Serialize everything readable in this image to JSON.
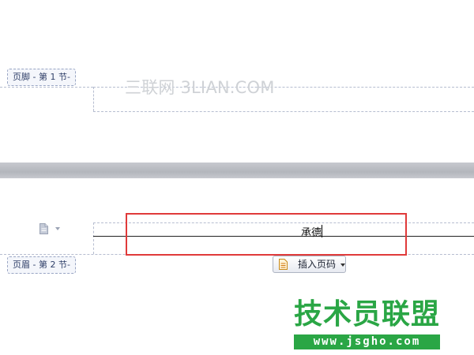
{
  "footer_section": {
    "tag_label": "页脚 - 第 1 节-"
  },
  "watermark": {
    "text": "三联网 3LIAN.COM"
  },
  "header_section": {
    "tag_label": "页眉 - 第 2 节-",
    "header_text": "承德",
    "doc_icon": "document-icon",
    "insert_page_number": {
      "label": "插入页码",
      "icon": "page-number-icon"
    }
  },
  "logo": {
    "main": "技术员联盟",
    "sub": "www.jsgho.com"
  },
  "colors": {
    "highlight": "#e03a3a",
    "logo_green": "#2aa645",
    "tag_text": "#2f3f68",
    "band": "#b3b6bc"
  }
}
